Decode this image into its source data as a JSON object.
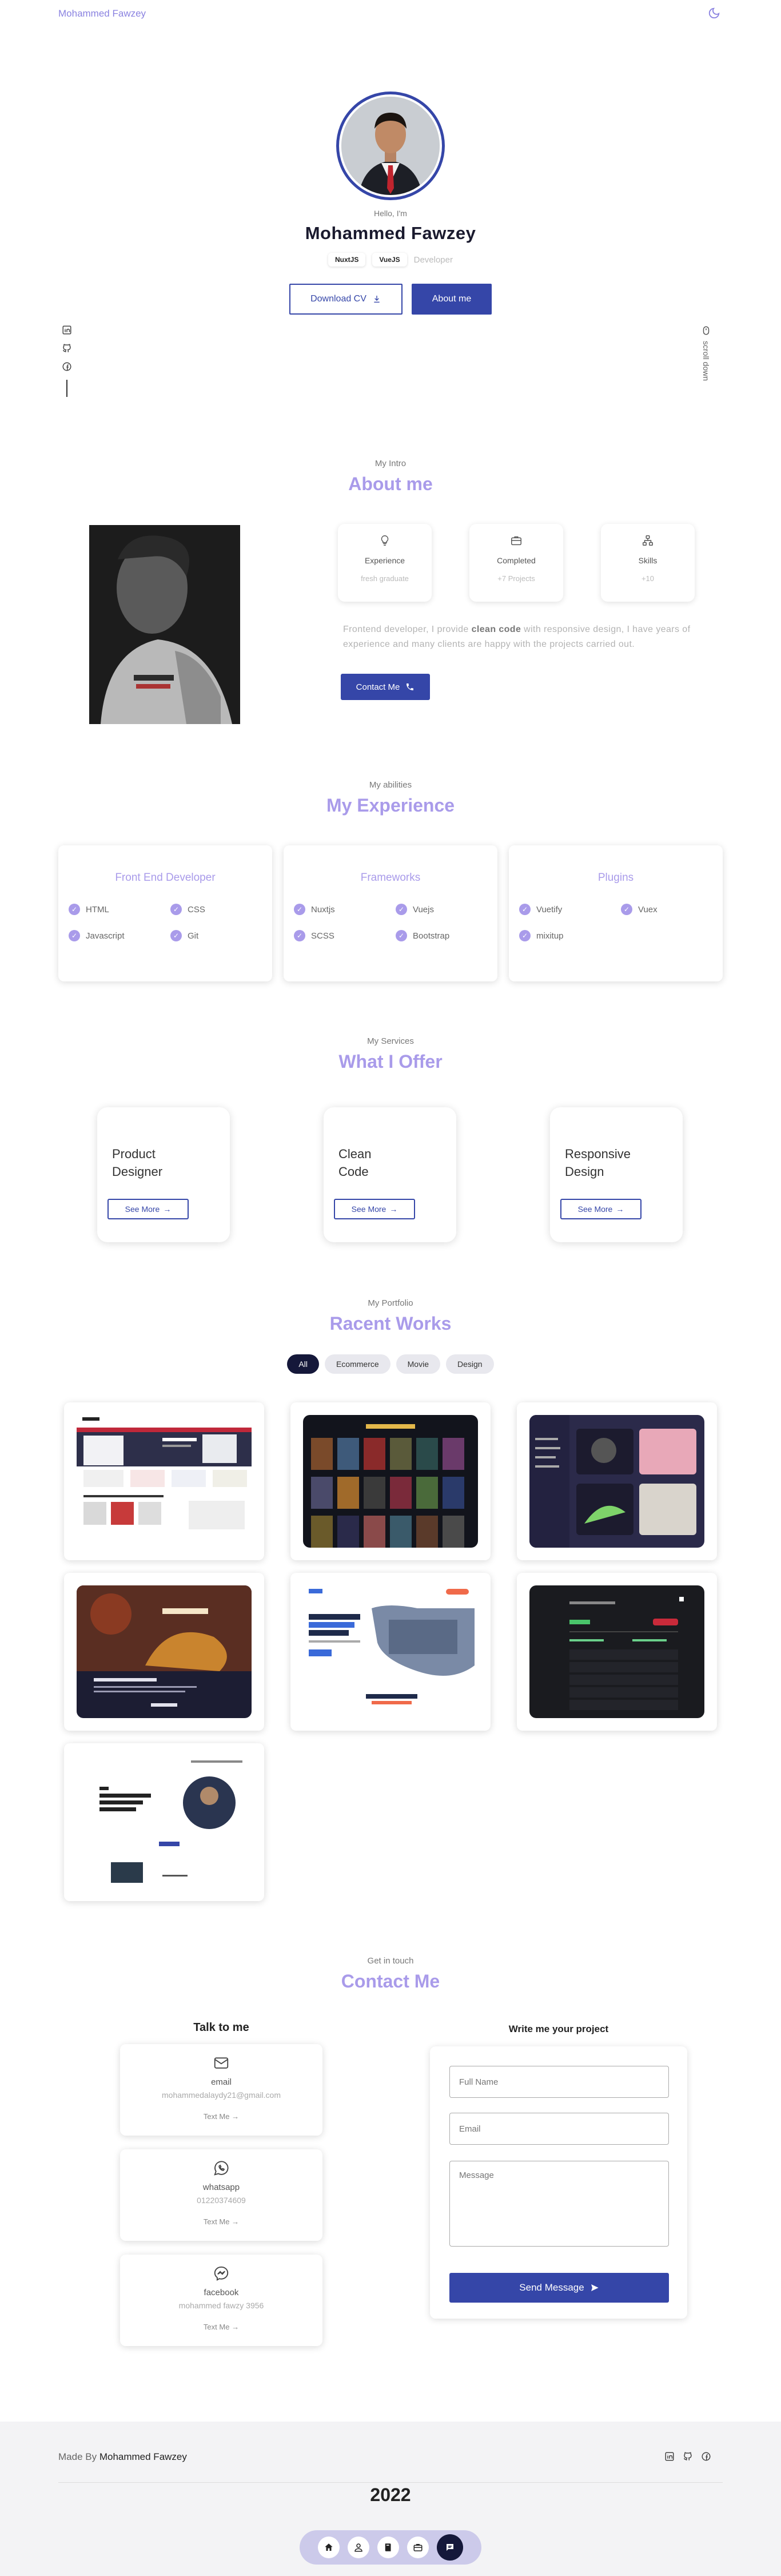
{
  "header": {
    "logo": "Mohammed Fawzey",
    "theme_icon": "moon-icon"
  },
  "hero": {
    "greeting": "Hello, I'm",
    "name": "Mohammed Fawzey",
    "tags": [
      "NuxtJS",
      "VueJS"
    ],
    "role": "Developer",
    "download_label": "Download CV",
    "about_label": "About me",
    "scroll_label": "scroll down",
    "social_icons": [
      "linkedin-icon",
      "github-icon",
      "facebook-icon"
    ]
  },
  "about": {
    "sub": "My Intro",
    "title": "About me",
    "stats": [
      {
        "label": "Experience",
        "value": "fresh graduate",
        "icon": "lightbulb-icon"
      },
      {
        "label": "Completed",
        "value": "+7 Projects",
        "icon": "briefcase-icon"
      },
      {
        "label": "Skills",
        "value": "+10",
        "icon": "network-icon"
      }
    ],
    "desc_before": "Frontend developer, I provide ",
    "desc_bold": "clean code",
    "desc_after": " with responsive design, I have years of experience and many clients are happy with the projects carried out.",
    "contact_label": "Contact Me"
  },
  "experience": {
    "sub": "My abilities",
    "title": "My Experience",
    "cards": [
      {
        "title": "Front End Developer",
        "items": [
          "HTML",
          "CSS",
          "Javascript",
          "Git"
        ]
      },
      {
        "title": "Frameworks",
        "items": [
          "Nuxtjs",
          "Vuejs",
          "SCSS",
          "Bootstrap"
        ]
      },
      {
        "title": "Plugins",
        "items": [
          "Vuetify",
          "Vuex",
          "mixitup"
        ]
      }
    ]
  },
  "offer": {
    "sub": "My Services",
    "title": "What I Offer",
    "cards": [
      {
        "line1": "Product",
        "line2": "Designer",
        "btn": "See More"
      },
      {
        "line1": "Clean",
        "line2": "Code",
        "btn": "See More"
      },
      {
        "line1": "Responsive",
        "line2": "Design",
        "btn": "See More"
      }
    ]
  },
  "portfolio": {
    "sub": "My Portfolio",
    "title": "Racent Works",
    "filters": [
      "All",
      "Ecommerce",
      "Movie",
      "Design"
    ],
    "active_filter": "All"
  },
  "contact": {
    "sub": "Get in touch",
    "title": "Contact Me",
    "talk_title": "Talk to me",
    "write_title": "Write me your project",
    "cards": [
      {
        "name": "email",
        "detail": "mohammedalaydy21@gmail.com",
        "link": "Text Me",
        "icon": "mail-icon"
      },
      {
        "name": "whatsapp",
        "detail": "01220374609",
        "link": "Text Me",
        "icon": "whatsapp-icon"
      },
      {
        "name": "facebook",
        "detail": "mohammed fawzy 3956",
        "link": "Text Me",
        "icon": "messenger-icon"
      }
    ],
    "form": {
      "name_placeholder": "Full Name",
      "email_placeholder": "Email",
      "message_placeholder": "Message",
      "send_label": "Send Message"
    }
  },
  "footer": {
    "made_by": "Made By",
    "made_by_name": "Mohammed Fawzey",
    "year": "2022",
    "dock_icons": [
      "home-icon",
      "user-icon",
      "book-icon",
      "briefcase-icon",
      "chat-icon"
    ]
  },
  "colors": {
    "primary": "#3546a8",
    "accent": "#a99bea",
    "dark": "#15183a"
  }
}
